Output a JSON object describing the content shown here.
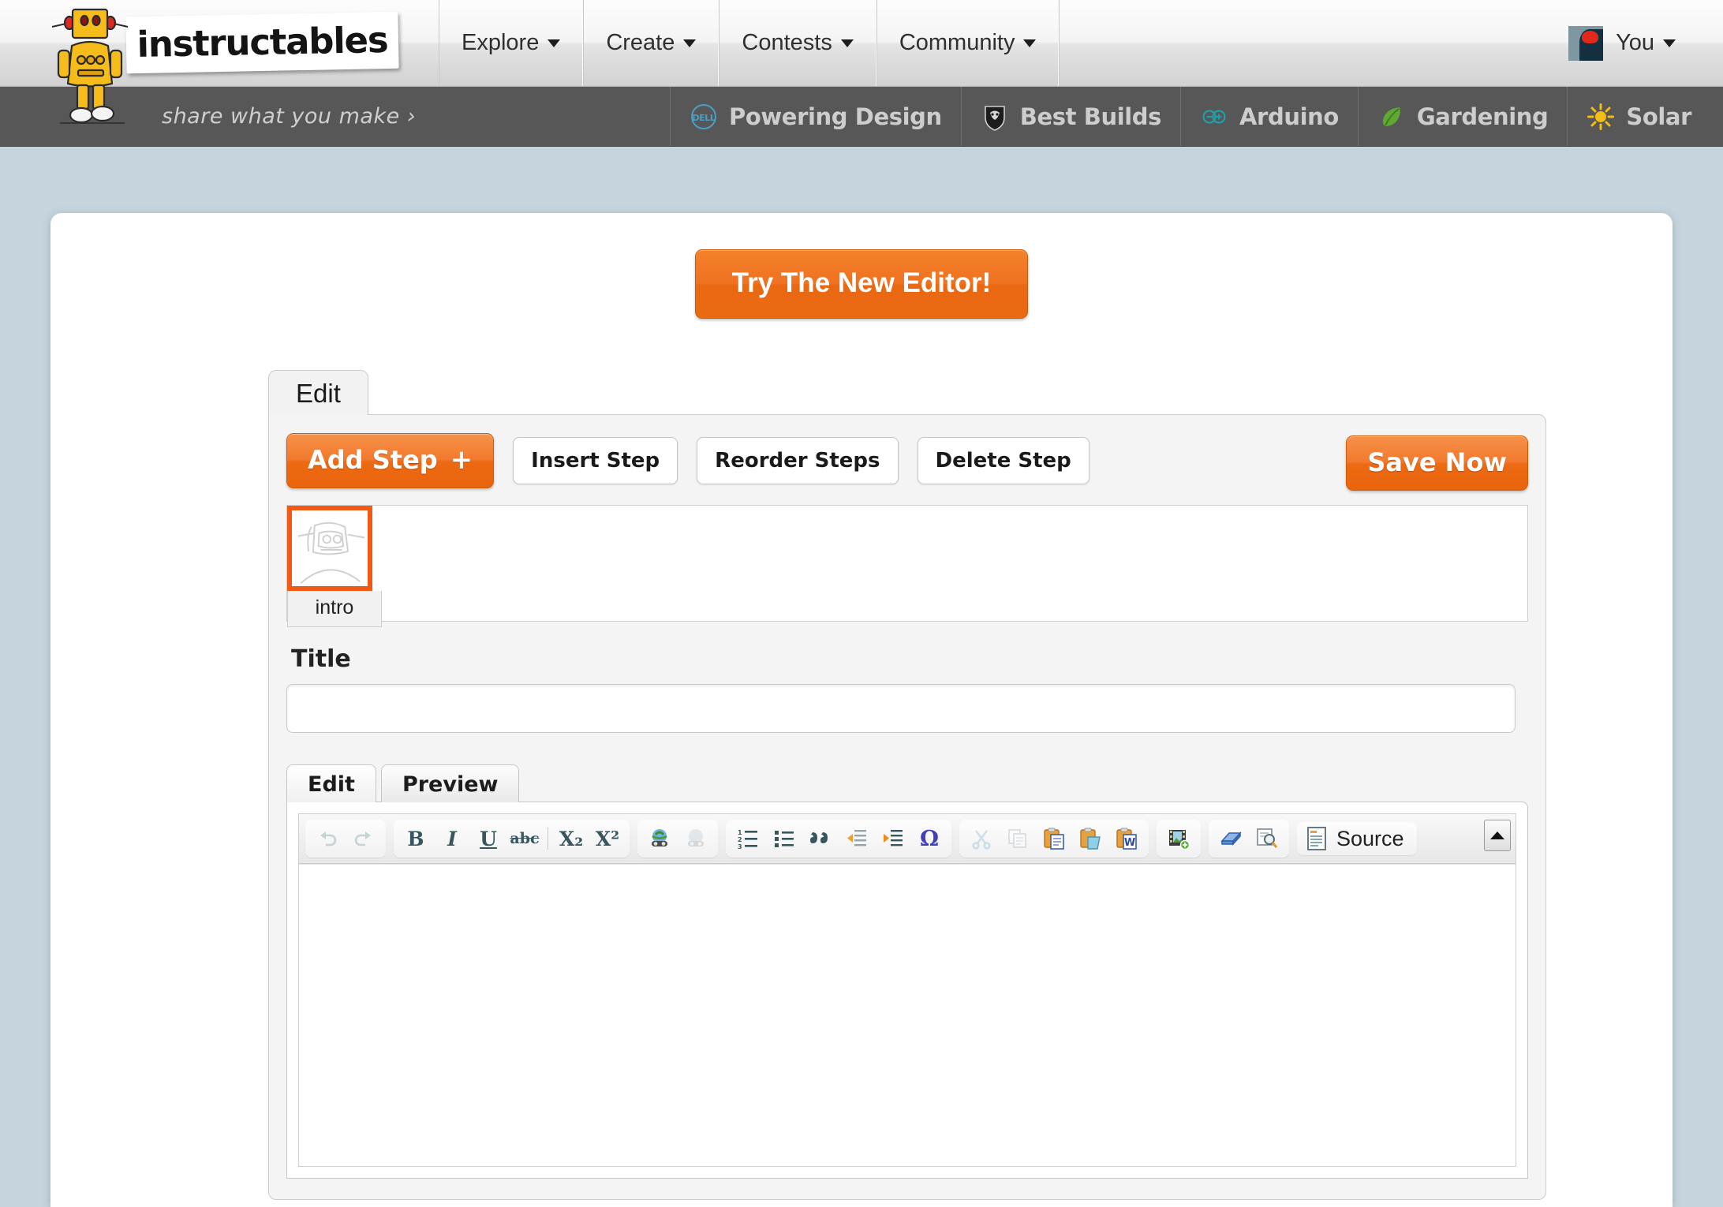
{
  "brand": {
    "wordmark": "instructables",
    "tagline": "share what you make  ›",
    "robot_icon": "robot-mascot-icon"
  },
  "topnav": {
    "items": [
      {
        "label": "Explore",
        "icon": "chevron-down-icon"
      },
      {
        "label": "Create",
        "icon": "chevron-down-icon"
      },
      {
        "label": "Contests",
        "icon": "chevron-down-icon"
      },
      {
        "label": "Community",
        "icon": "chevron-down-icon"
      }
    ],
    "account": {
      "label": "You",
      "icon": "chevron-down-icon",
      "avatar": "user-avatar"
    }
  },
  "darkbar": {
    "links": [
      {
        "label": "Powering Design",
        "icon": "dell-circle-icon"
      },
      {
        "label": "Best Builds",
        "icon": "shield-ram-icon"
      },
      {
        "label": "Arduino",
        "icon": "arduino-infinity-icon"
      },
      {
        "label": "Gardening",
        "icon": "leaf-icon"
      },
      {
        "label": "Solar",
        "icon": "sun-icon"
      }
    ]
  },
  "main": {
    "cta_label": "Try The New Editor!",
    "tab_label": "Edit",
    "step_buttons": {
      "add_step": "Add Step",
      "add_step_plus": "+",
      "insert_step": "Insert Step",
      "reorder_steps": "Reorder Steps",
      "delete_step": "Delete Step",
      "save_now": "Save Now"
    },
    "steps": [
      {
        "label": "intro",
        "thumbnail": "robot-sketch-thumbnail",
        "selected": true
      }
    ],
    "title_field": {
      "label": "Title",
      "value": "",
      "placeholder": ""
    },
    "content_tabs": [
      {
        "label": "Edit",
        "active": true
      },
      {
        "label": "Preview",
        "active": false
      }
    ],
    "editor": {
      "source_label": "Source",
      "body_value": "",
      "collapse_icon": "collapse-toolbar-icon",
      "toolbar": [
        {
          "name": "undo-icon",
          "glyph": "↶",
          "disabled": true
        },
        {
          "name": "redo-icon",
          "glyph": "↷",
          "disabled": true
        },
        {
          "name": "bold-icon",
          "glyph": "B",
          "disabled": false
        },
        {
          "name": "italic-icon",
          "glyph": "I",
          "disabled": false
        },
        {
          "name": "underline-icon",
          "glyph": "U",
          "disabled": false
        },
        {
          "name": "strikethrough-icon",
          "glyph": "abc",
          "disabled": false
        },
        {
          "name": "subscript-icon",
          "glyph": "X₂",
          "disabled": false
        },
        {
          "name": "superscript-icon",
          "glyph": "X²",
          "disabled": false
        },
        {
          "name": "link-icon",
          "glyph": "",
          "disabled": false
        },
        {
          "name": "unlink-icon",
          "glyph": "",
          "disabled": true
        },
        {
          "name": "numbered-list-icon",
          "glyph": "",
          "disabled": false
        },
        {
          "name": "bulleted-list-icon",
          "glyph": "",
          "disabled": false
        },
        {
          "name": "blockquote-icon",
          "glyph": "””",
          "disabled": false
        },
        {
          "name": "outdent-icon",
          "glyph": "",
          "disabled": false
        },
        {
          "name": "indent-icon",
          "glyph": "",
          "disabled": false
        },
        {
          "name": "special-character-icon",
          "glyph": "Ω",
          "disabled": false
        },
        {
          "name": "cut-icon",
          "glyph": "",
          "disabled": true
        },
        {
          "name": "copy-icon",
          "glyph": "",
          "disabled": true
        },
        {
          "name": "paste-icon",
          "glyph": "",
          "disabled": false
        },
        {
          "name": "paste-as-plain-text-icon",
          "glyph": "",
          "disabled": false
        },
        {
          "name": "paste-from-word-icon",
          "glyph": "",
          "disabled": false
        },
        {
          "name": "insert-image-icon",
          "glyph": "",
          "disabled": false
        },
        {
          "name": "remove-format-icon",
          "glyph": "",
          "disabled": false
        },
        {
          "name": "find-replace-icon",
          "glyph": "",
          "disabled": false
        }
      ]
    }
  },
  "colors": {
    "accent_orange": "#ee6c13",
    "page_background": "#c6d5dd",
    "dark_bar": "#575757",
    "selection_border": "#f05a14"
  }
}
